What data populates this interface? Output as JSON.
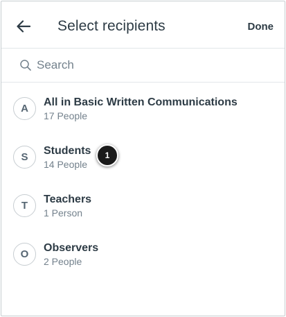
{
  "header": {
    "title": "Select recipients",
    "done_label": "Done",
    "back_icon": "arrow-left-icon"
  },
  "search": {
    "placeholder": "Search",
    "value": "",
    "icon": "search-icon"
  },
  "recipients": [
    {
      "initial": "A",
      "name": "All in Basic Written Communications",
      "count": "17 People"
    },
    {
      "initial": "S",
      "name": "Students",
      "count": "14 People"
    },
    {
      "initial": "T",
      "name": "Teachers",
      "count": "1 Person"
    },
    {
      "initial": "O",
      "name": "Observers",
      "count": "2 People"
    }
  ],
  "callout": {
    "number": "1"
  },
  "colors": {
    "text": "#2d3b45",
    "muted": "#73818c",
    "border": "#c7cdd1",
    "callout": "#1a1a1a"
  }
}
